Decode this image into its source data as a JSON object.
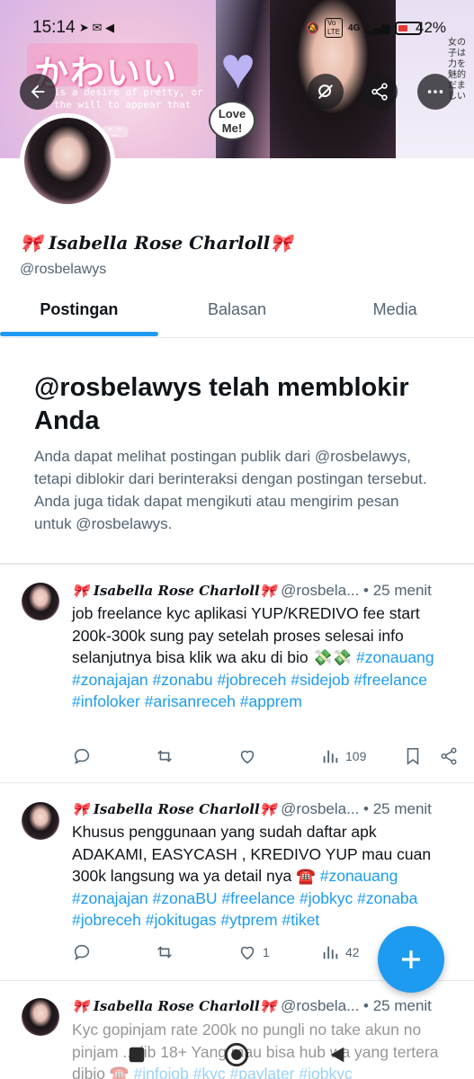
{
  "status_bar": {
    "time": "15:14",
    "network_chip": "Vo\nLTE",
    "network_type": "4G",
    "battery_percent": "42%",
    "battery_level": 0.42
  },
  "banner": {
    "kawaii_text": "かわいい",
    "caption": "is a desire of pretty, or the will to appear that way",
    "love_text": "Love\nMe!",
    "side_text": "女の子は力を魅的だましい",
    "tag_text": "^_^"
  },
  "profile": {
    "display_name": "🎀 Isabella Rose Charloll🎀",
    "handle": "@rosbelawys"
  },
  "tabs": [
    {
      "label": "Postingan",
      "active": true
    },
    {
      "label": "Balasan",
      "active": false
    },
    {
      "label": "Media",
      "active": false
    }
  ],
  "block_notice": {
    "title": "@rosbelawys telah memblokir Anda",
    "description": "Anda dapat melihat postingan publik dari @rosbelawys, tetapi diblokir dari berinteraksi dengan postingan tersebut. Anda juga tidak dapat mengikuti atau mengirim pesan untuk @rosbelawys."
  },
  "tweets": [
    {
      "name": "🎀 Isabella Rose Charloll🎀",
      "handle": "@rosbela...",
      "time": "• 25 menit",
      "text": "job freelance kyc aplikasi YUP/KREDIVO fee start 200k-300k sung pay setelah proses selesai info selanjutnya bisa klik wa aku di bio 💸💸",
      "tags": "#zonauang #zonajajan #zonabu #jobreceh #sidejob #freelance  #infoloker #arisanreceh #apprem",
      "reply_count": "",
      "retweet_count": "",
      "like_count": "",
      "view_count": "109"
    },
    {
      "name": "🎀 Isabella Rose Charloll🎀",
      "handle": "@rosbela...",
      "time": "• 25 menit",
      "text": "Khusus penggunaan yang sudah daftar apk ADAKAMI, EASYCASH , KREDIVO YUP mau cuan 300k langsung wa ya detail nya ☎️",
      "tags": "#zonauang #zonajajan #zonaBU #freelance #jobkyc #zonaba #jobreceh #jokitugas #ytprem #tiket",
      "reply_count": "",
      "retweet_count": "",
      "like_count": "1",
      "view_count": "42"
    },
    {
      "name": "🎀 Isabella Rose Charloll🎀",
      "handle": "@rosbela...",
      "time": "• 25 menit",
      "text": "Kyc gopinjam rate 200k no pungli no take akun no pinjam ... jib 18+ Yang mau bisa hub wa yang tertera dibio ☎️",
      "tags": "#infojob #kyc #paylater #jobkyc"
    }
  ],
  "colors": {
    "accent": "#1d9bf0",
    "text_secondary": "#536471",
    "divider": "#e6e9ec"
  },
  "icons": {
    "back": "arrow-left-icon",
    "search": "search-icon",
    "share": "share-icon",
    "more": "more-vert-icon"
  }
}
